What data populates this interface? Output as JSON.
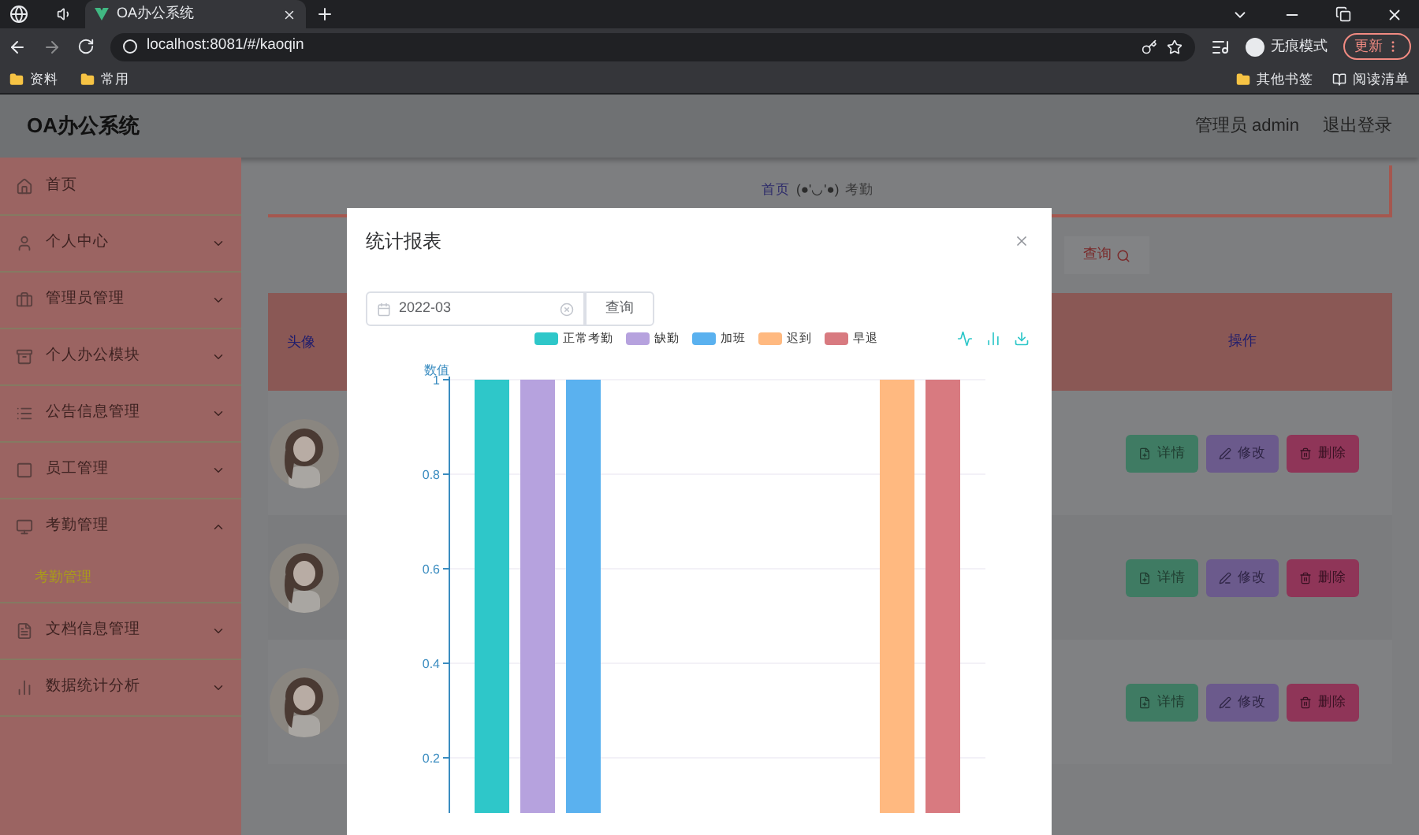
{
  "browser": {
    "tabs": [
      {
        "title": "OA办公系统",
        "selected": true
      }
    ],
    "address": "localhost:8081/#/kaoqin",
    "profile": "无痕模式",
    "update_button": "更新",
    "bookmarks": [
      "资料",
      "常用"
    ],
    "bookmarks_right": [
      "其他书签",
      "阅读清单"
    ]
  },
  "header": {
    "title": "OA办公系统",
    "user": "管理员 admin",
    "logout": "退出登录"
  },
  "sidebar": {
    "items": [
      {
        "label": "首页"
      },
      {
        "label": "个人中心",
        "expanded": false
      },
      {
        "label": "管理员管理",
        "expanded": false
      },
      {
        "label": "个人办公模块",
        "expanded": false
      },
      {
        "label": "公告信息管理",
        "expanded": false
      },
      {
        "label": "员工管理",
        "expanded": false
      },
      {
        "label": "考勤管理",
        "expanded": true,
        "children": [
          {
            "label": "考勤管理",
            "selected": true
          }
        ]
      },
      {
        "label": "文档信息管理",
        "expanded": false
      },
      {
        "label": "数据统计分析",
        "expanded": false
      }
    ]
  },
  "breadcrumb": {
    "home": "首页",
    "separator": "(●'◡'●)",
    "current": "考勤"
  },
  "search_button": "查询",
  "table": {
    "columns": [
      "头像",
      "操作"
    ],
    "rows": [
      {
        "actions": [
          {
            "kind": "detail",
            "label": "详情"
          },
          {
            "kind": "edit",
            "label": "修改"
          },
          {
            "kind": "delete",
            "label": "删除"
          }
        ]
      },
      {
        "actions": [
          {
            "kind": "detail",
            "label": "详情"
          },
          {
            "kind": "edit",
            "label": "修改"
          },
          {
            "kind": "delete",
            "label": "删除"
          }
        ]
      },
      {
        "actions": [
          {
            "kind": "detail",
            "label": "详情"
          },
          {
            "kind": "edit",
            "label": "修改"
          },
          {
            "kind": "delete",
            "label": "删除"
          }
        ]
      }
    ]
  },
  "modal": {
    "title": "统计报表",
    "date": "2022-03",
    "query_button": "查询",
    "chart_data": {
      "type": "bar",
      "ylabel": "数值",
      "grid": true,
      "ylim": [
        0,
        1
      ],
      "yticks": [
        0.2,
        0.4,
        0.6,
        0.8,
        1
      ],
      "series": [
        {
          "name": "正常考勤",
          "color": "#2ec7c9",
          "values": [
            1,
            0
          ]
        },
        {
          "name": "缺勤",
          "color": "#b6a2de",
          "values": [
            1,
            0
          ]
        },
        {
          "name": "加班",
          "color": "#5ab1ef",
          "values": [
            1,
            0
          ]
        },
        {
          "name": "迟到",
          "color": "#ffb980",
          "values": [
            0,
            1
          ]
        },
        {
          "name": "早退",
          "color": "#d87a80",
          "values": [
            0,
            1
          ]
        }
      ]
    }
  }
}
